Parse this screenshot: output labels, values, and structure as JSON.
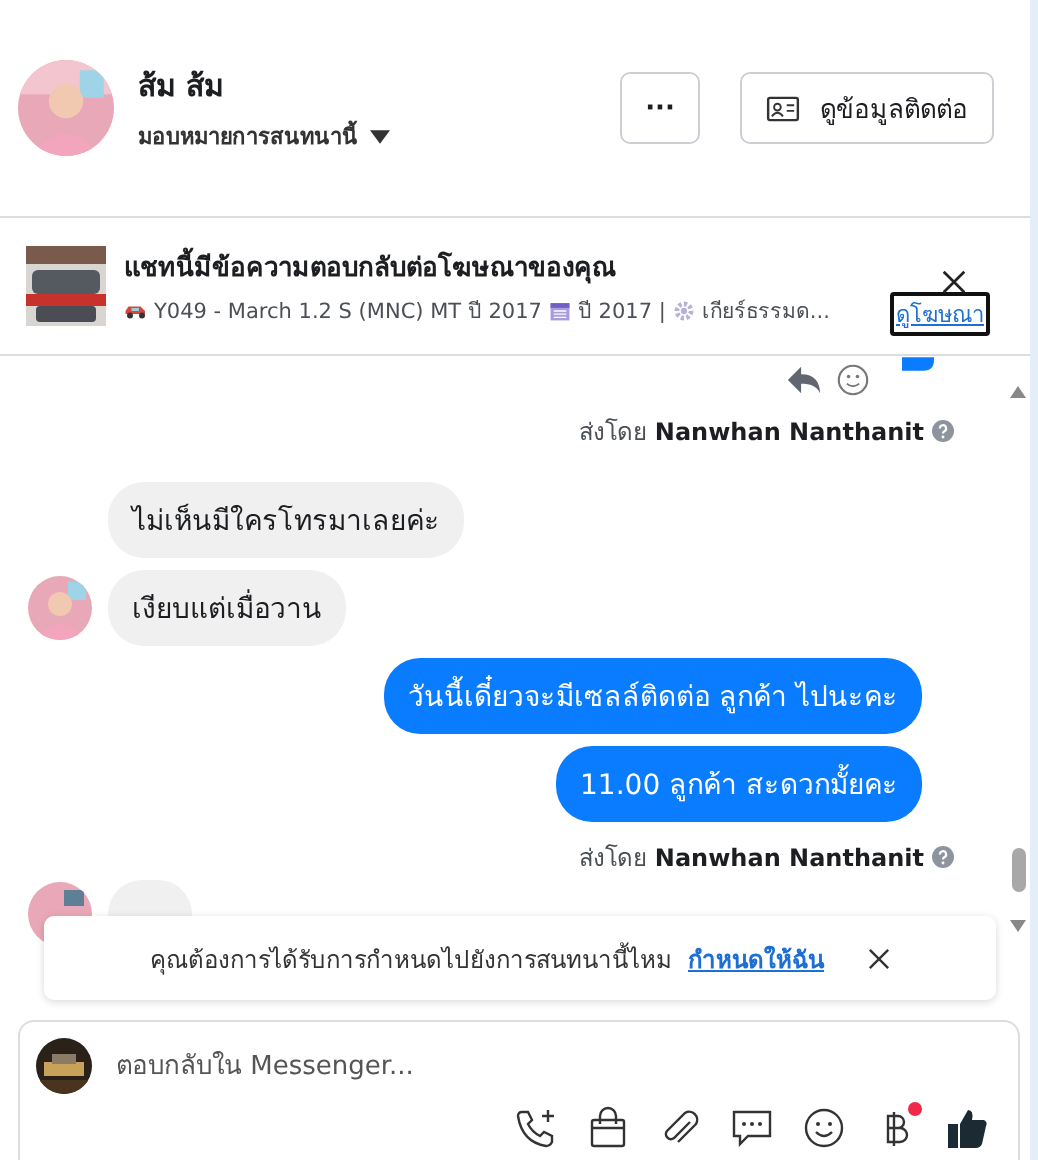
{
  "header": {
    "name": "ส้ม ส้ม",
    "assign": "มอบหมายการสนทนานี้",
    "more_button": "···",
    "contact_button": "ดูข้อมูลติดต่อ"
  },
  "ad": {
    "title": "แชทนี้มีข้อความตอบกลับต่อโฆษณาของคุณ",
    "segments": [
      {
        "kind": "car",
        "text": "Y049 - March 1.2 S (MNC) MT ปี 2017"
      },
      {
        "kind": "calendar",
        "text": "ปี 2017 |"
      },
      {
        "kind": "gear",
        "text": "เกียร์ธรรมด..."
      }
    ],
    "link": "ดูโฆษณา"
  },
  "messages": [
    {
      "kind": "note",
      "text": "ส่งโดย **Nanwhan Nanthanit**"
    },
    {
      "kind": "incoming",
      "text": "ไม่เห็นมีใครโทรมาเลยค่ะ",
      "show_avatar": false
    },
    {
      "kind": "incoming",
      "text": "เงียบแต่เมื่อวาน",
      "show_avatar": true
    },
    {
      "kind": "outgoing",
      "text": "วันนี้เดี๋ยวจะมีเซลล์ติดต่อ ลูกค้า ไปนะคะ"
    },
    {
      "kind": "outgoing",
      "text": "11.00 ลูกค้า สะดวกมั้ยคะ"
    },
    {
      "kind": "note",
      "text": "ส่งโดย **Nanwhan Nanthanit**"
    }
  ],
  "prompt": {
    "text": "คุณต้องการได้รับการกำหนดไปยังการสนทนานี้ไหม",
    "link": "กำหนดให้ฉัน"
  },
  "composer": {
    "placeholder": "ตอบกลับใน Messenger...",
    "tools": [
      {
        "kind": "call",
        "badge": false
      },
      {
        "kind": "bag",
        "badge": false
      },
      {
        "kind": "clip",
        "badge": false
      },
      {
        "kind": "chat",
        "badge": false
      },
      {
        "kind": "emoji",
        "badge": false
      },
      {
        "kind": "baht",
        "badge": true
      },
      {
        "kind": "like",
        "badge": false
      }
    ]
  }
}
